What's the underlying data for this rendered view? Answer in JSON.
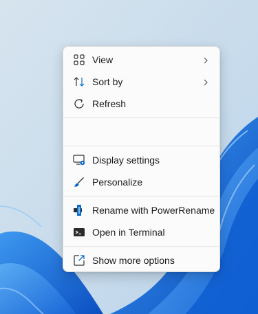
{
  "menu": {
    "items": [
      {
        "label": "View",
        "icon": "grid-icon",
        "has_submenu": true
      },
      {
        "label": "Sort by",
        "icon": "sort-arrows-icon",
        "has_submenu": true
      },
      {
        "label": "Refresh",
        "icon": "refresh-icon",
        "has_submenu": false
      },
      {
        "label": "Display settings",
        "icon": "display-settings-icon",
        "has_submenu": false
      },
      {
        "label": "Personalize",
        "icon": "brush-icon",
        "has_submenu": false
      },
      {
        "label": "Rename with PowerRename",
        "icon": "powerrename-icon",
        "has_submenu": false
      },
      {
        "label": "Open in Terminal",
        "icon": "terminal-icon",
        "has_submenu": false
      },
      {
        "label": "Show more options",
        "icon": "show-more-options-icon",
        "has_submenu": false
      }
    ]
  },
  "colors": {
    "accent": "#0a6cc9",
    "menu_bg": "#fbfbfb",
    "desktop_bg": "#cfe0ee",
    "wave_blue": "#1a74e0"
  }
}
